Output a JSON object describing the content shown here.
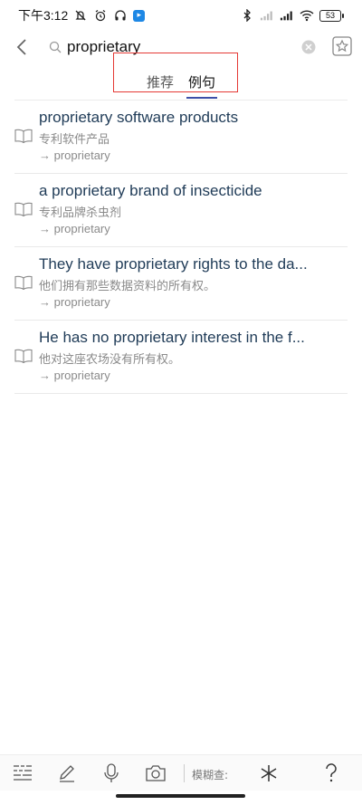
{
  "status": {
    "time": "下午3:12",
    "battery": "53"
  },
  "search": {
    "query": "proprietary"
  },
  "tabs": [
    {
      "label": "推荐"
    },
    {
      "label": "例句"
    }
  ],
  "examples": [
    {
      "en": "proprietary software products",
      "zh": "专利软件产品",
      "link": "→ proprietary"
    },
    {
      "en": "a proprietary brand of insecticide",
      "zh": "专利品牌杀虫剂",
      "link": "→ proprietary"
    },
    {
      "en": "They have proprietary rights to the da...",
      "zh": "他们拥有那些数据资料的所有权。",
      "link": "→ proprietary"
    },
    {
      "en": "He has no proprietary interest in the f...",
      "zh": "他对这座农场没有所有权。",
      "link": "→ proprietary"
    }
  ],
  "toolbar": {
    "fuzzy_label": "模糊查:"
  },
  "colors": {
    "accent": "#3d4fa8",
    "highlight": "#e53935",
    "title": "#1f3b57"
  }
}
